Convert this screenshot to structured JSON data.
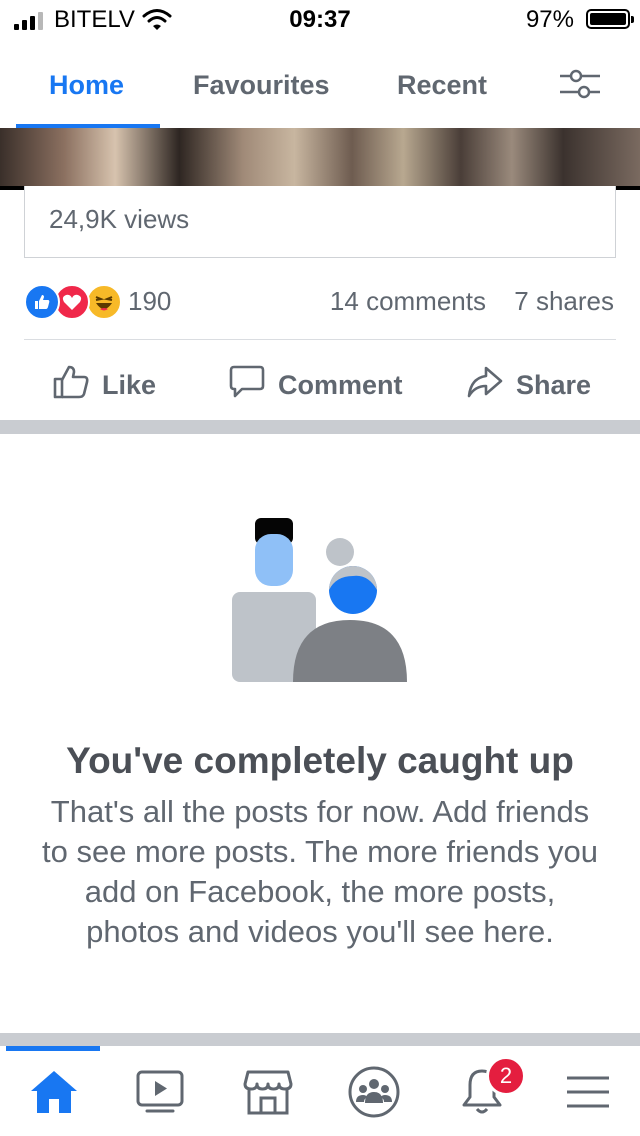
{
  "status_bar": {
    "carrier": "BITELV",
    "time": "09:37",
    "battery": "97%"
  },
  "tabs": [
    {
      "label": "Home",
      "active": true
    },
    {
      "label": "Favourites",
      "active": false
    },
    {
      "label": "Recent",
      "active": false
    }
  ],
  "post": {
    "views": "24,9K views",
    "reaction_count": "190",
    "comments": "14 comments",
    "shares": "7 shares",
    "actions": {
      "like": "Like",
      "comment": "Comment",
      "share": "Share"
    }
  },
  "caught_up": {
    "title": "You've completely caught up",
    "body": "That's all the posts for now. Add friends to see more posts. The more friends you add on Facebook, the more posts, photos and videos you'll see here."
  },
  "bottom_nav": {
    "notifications_badge": "2",
    "active_item": "home"
  },
  "colors": {
    "accent": "#1877f2",
    "badge": "#e41e3f",
    "like_reaction": "#1877f2",
    "love_reaction": "#f0284a",
    "haha_reaction": "#f7b928"
  },
  "icons": [
    "signal-icon",
    "wifi-icon",
    "battery-icon",
    "filter-icon",
    "like-reaction-icon",
    "love-reaction-icon",
    "haha-reaction-icon",
    "thumbs-up-icon",
    "comment-icon",
    "share-arrow-icon",
    "home-icon",
    "watch-icon",
    "marketplace-icon",
    "groups-icon",
    "bell-icon",
    "menu-icon"
  ]
}
